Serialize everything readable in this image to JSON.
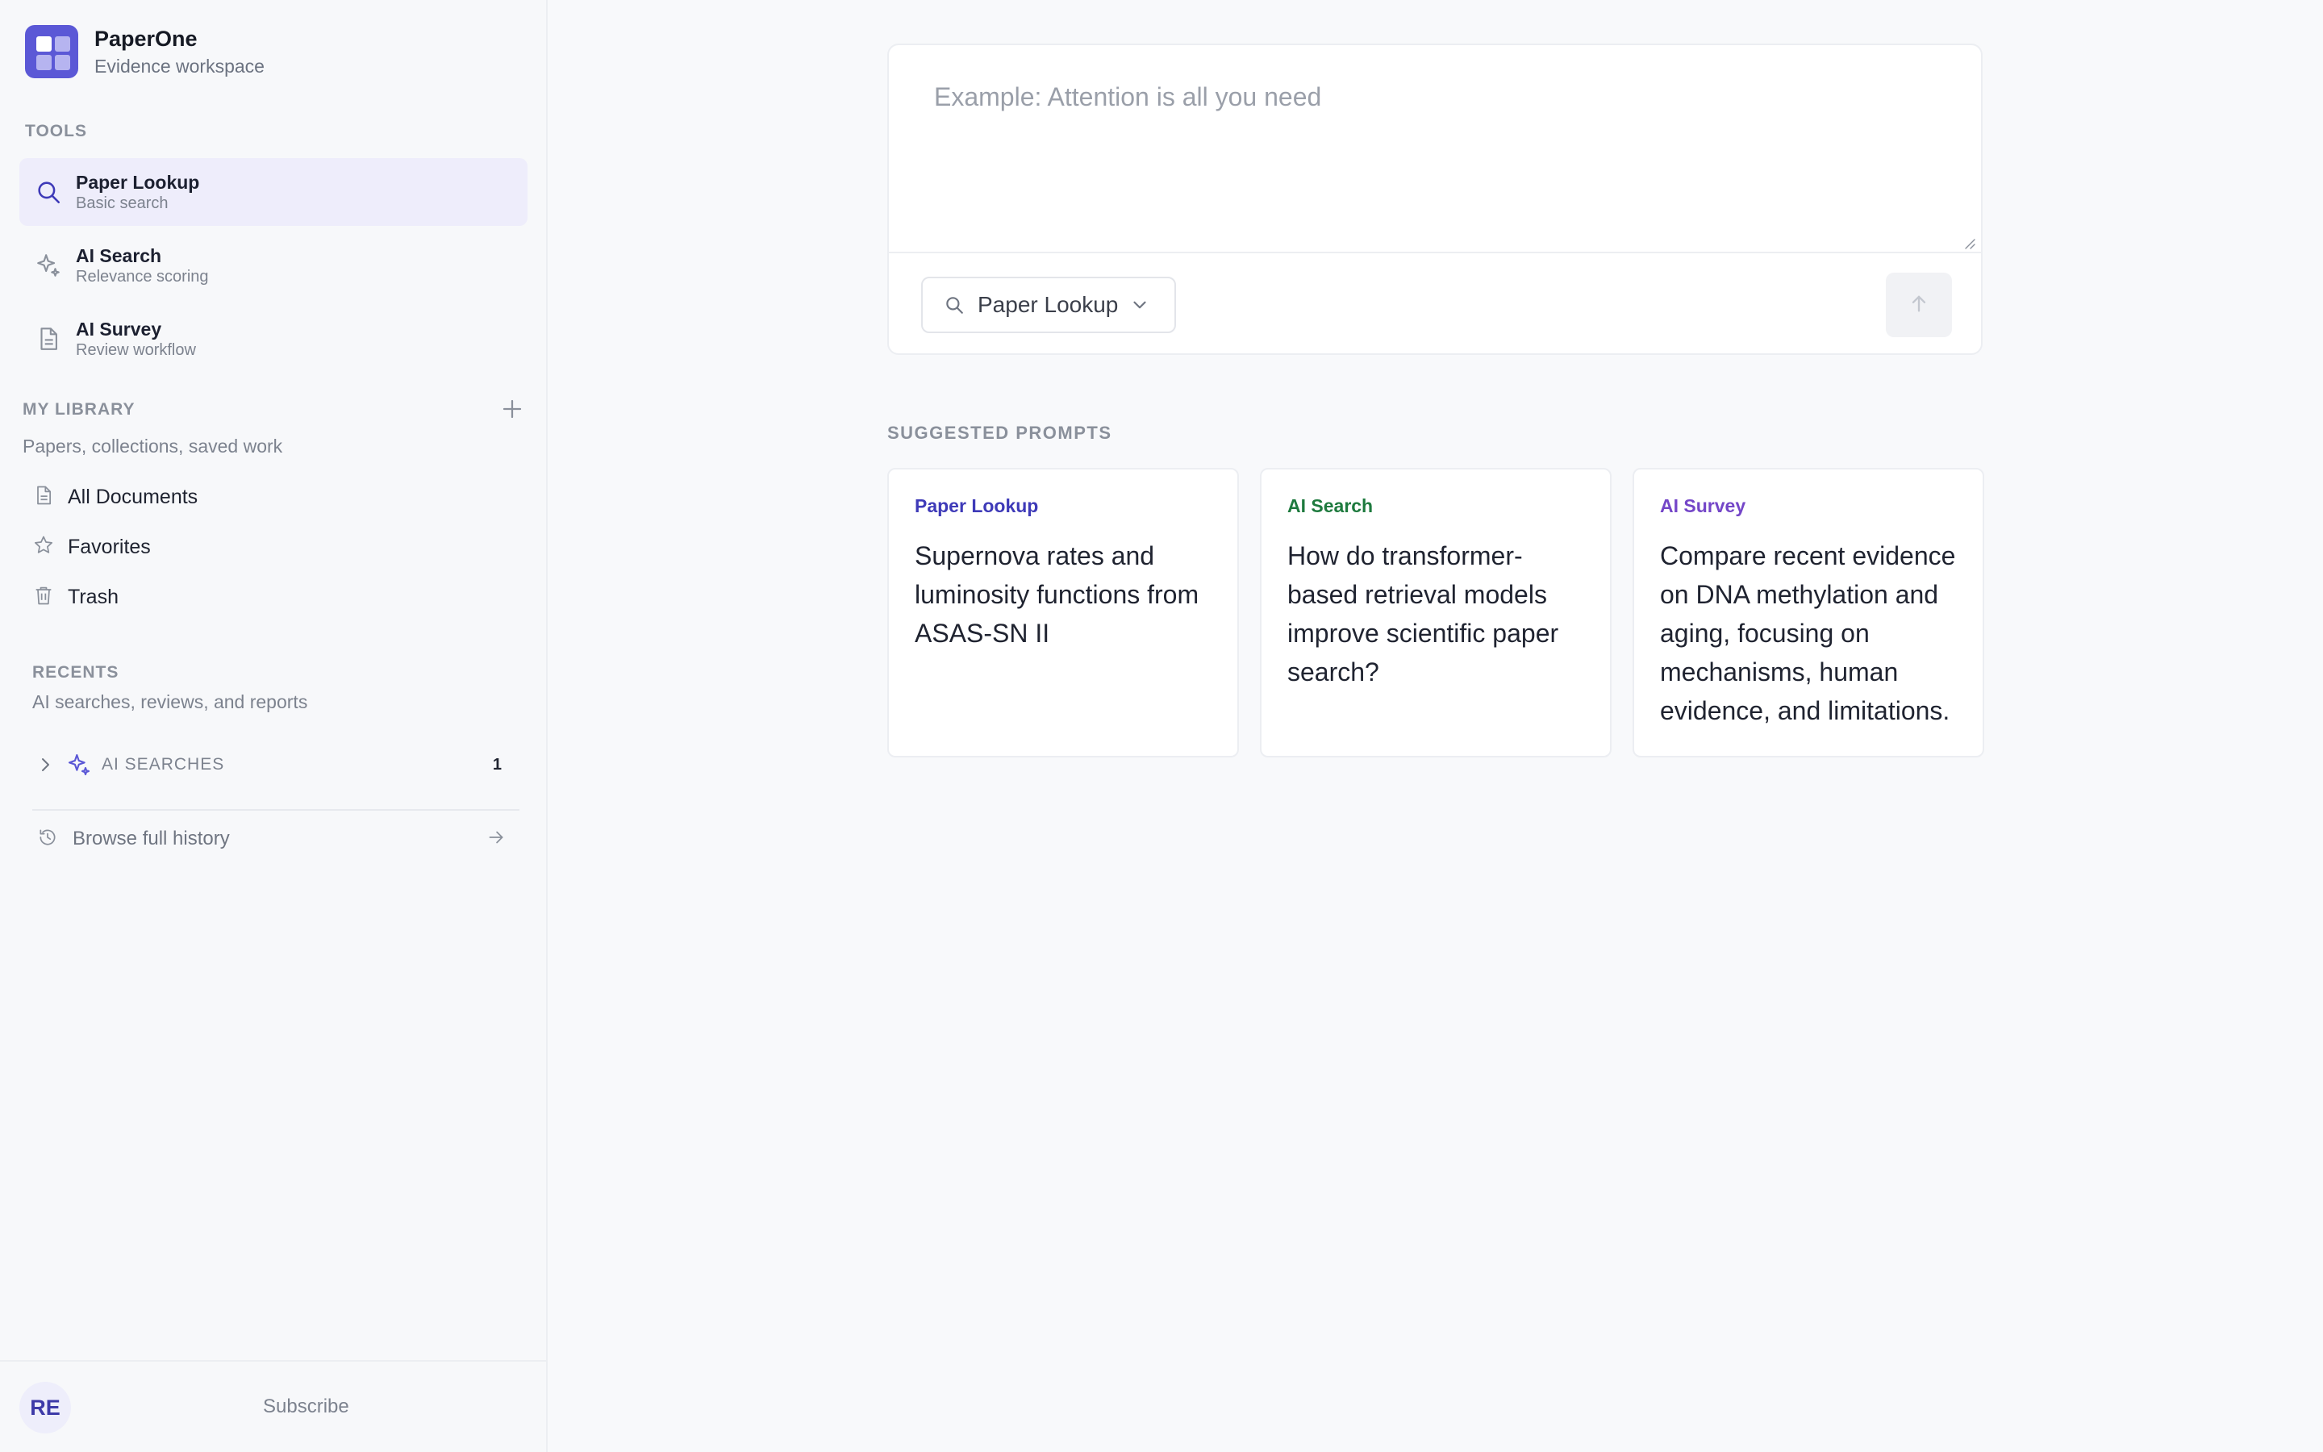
{
  "brand": {
    "title": "PaperOne",
    "subtitle": "Evidence workspace"
  },
  "sidebar": {
    "tools_label": "TOOLS",
    "tools": [
      {
        "title": "Paper Lookup",
        "subtitle": "Basic search",
        "icon": "search-icon",
        "active": true
      },
      {
        "title": "AI Search",
        "subtitle": "Relevance scoring",
        "icon": "sparkle-icon",
        "active": false
      },
      {
        "title": "AI Survey",
        "subtitle": "Review workflow",
        "icon": "document-icon",
        "active": false
      }
    ],
    "library_label": "MY LIBRARY",
    "library_desc": "Papers, collections, saved work",
    "library_items": [
      {
        "label": "All Documents",
        "icon": "document-icon"
      },
      {
        "label": "Favorites",
        "icon": "star-icon"
      },
      {
        "label": "Trash",
        "icon": "trash-icon"
      }
    ],
    "recents_label": "RECENTS",
    "recents_desc": "AI searches, reviews, and reports",
    "ai_searches": {
      "label": "AI SEARCHES",
      "count": "1"
    },
    "browse_history": "Browse full history",
    "user_initials": "RE",
    "subscribe": "Subscribe"
  },
  "composer": {
    "placeholder": "Example: Attention is all you need",
    "value": "",
    "mode": "Paper Lookup"
  },
  "suggested": {
    "label": "SUGGESTED PROMPTS",
    "cards": [
      {
        "tag": "Paper Lookup",
        "tag_color": "#3e3ab8",
        "prompt": "Supernova rates and luminosity functions from ASAS-SN II"
      },
      {
        "tag": "AI Search",
        "tag_color": "#1e7a3e",
        "prompt": "How do transformer-based retrieval models improve scientific paper search?"
      },
      {
        "tag": "AI Survey",
        "tag_color": "#7446c8",
        "prompt": "Compare recent evidence on DNA methylation and aging, focusing on mechanisms, human evidence, and limitations."
      }
    ]
  },
  "colors": {
    "accent": "#5b58d6",
    "active_bg": "#eeedfb"
  }
}
